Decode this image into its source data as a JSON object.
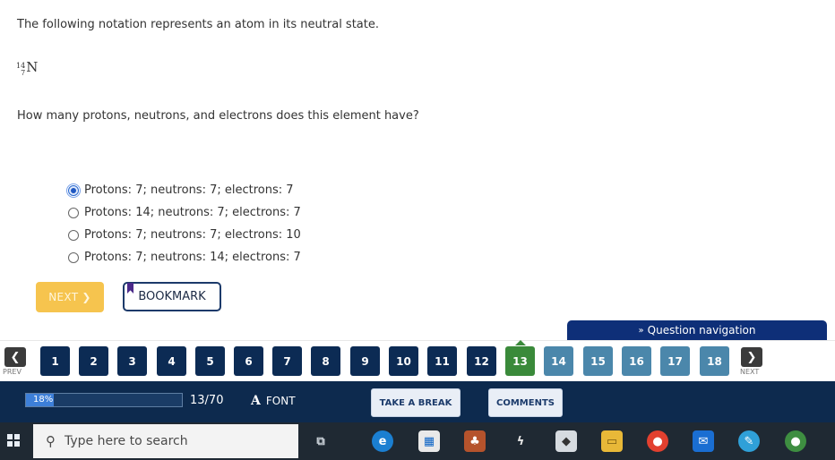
{
  "question": {
    "intro": "The following notation represents an atom in its neutral state.",
    "notation": {
      "mass": "14",
      "atomic": "7",
      "symbol": "N"
    },
    "prompt": "How many protons, neutrons, and electrons does this element have?"
  },
  "options": [
    {
      "label": "Protons: 7; neutrons: 7; electrons: 7",
      "selected": true
    },
    {
      "label": "Protons: 14; neutrons: 7; electrons: 7",
      "selected": false
    },
    {
      "label": "Protons: 7; neutrons: 7; electrons: 10",
      "selected": false
    },
    {
      "label": "Protons: 7; neutrons: 14; electrons: 7",
      "selected": false
    }
  ],
  "actions": {
    "next_label": "NEXT",
    "bookmark_label": "BOOKMARK"
  },
  "question_nav": {
    "tab_label": "Question navigation",
    "prev_label": "PREV",
    "next_label": "NEXT",
    "numbers": [
      "1",
      "2",
      "3",
      "4",
      "5",
      "6",
      "7",
      "8",
      "9",
      "10",
      "11",
      "12",
      "13",
      "14",
      "15",
      "16",
      "17",
      "18"
    ],
    "current": "13"
  },
  "status": {
    "progress_percent": 18,
    "progress_label": "18%",
    "question_count": "13/70",
    "font_label": "FONT",
    "font_icon": "A",
    "take_break_label": "TAKE A BREAK",
    "comments_label": "COMMENTS"
  },
  "taskbar": {
    "search_placeholder": "Type here to search",
    "icons": [
      "windows-logo",
      "task-view-icon",
      "edge-icon",
      "store-icon",
      "game-icon",
      "winamp-icon",
      "roblox-icon",
      "file-explorer-icon",
      "chrome-icon",
      "mail-icon",
      "paint-icon",
      "chrome-profile-icon"
    ]
  },
  "colors": {
    "navy": "#0c2b54",
    "current_green": "#3a8a3a",
    "upcoming_blue": "#4b87ab",
    "next_button_yellow": "#f6c44e",
    "statusbar": "#0d2a4e"
  }
}
